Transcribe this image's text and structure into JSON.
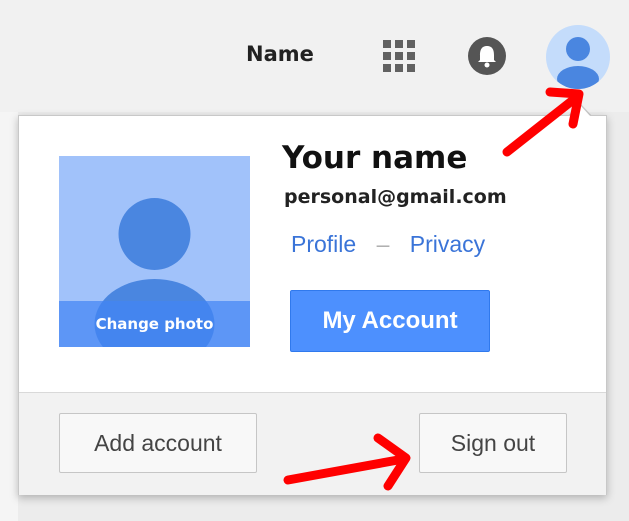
{
  "header": {
    "name": "Name",
    "apps_icon": "apps-grid-icon",
    "notifications_icon": "bell-icon",
    "avatar_icon": "account-avatar-icon"
  },
  "account_popup": {
    "photo_label": "Change photo",
    "name": "Your name",
    "email": "personal@gmail.com",
    "profile_link": "Profile",
    "separator": "–",
    "privacy_link": "Privacy",
    "my_account_label": "My Account",
    "add_account_label": "Add account",
    "sign_out_label": "Sign out"
  },
  "colors": {
    "accent_blue": "#4d90fe",
    "link_blue": "#3a74d8",
    "avatar_blue": "#4a86e0",
    "annotation_red": "#ff0000"
  }
}
